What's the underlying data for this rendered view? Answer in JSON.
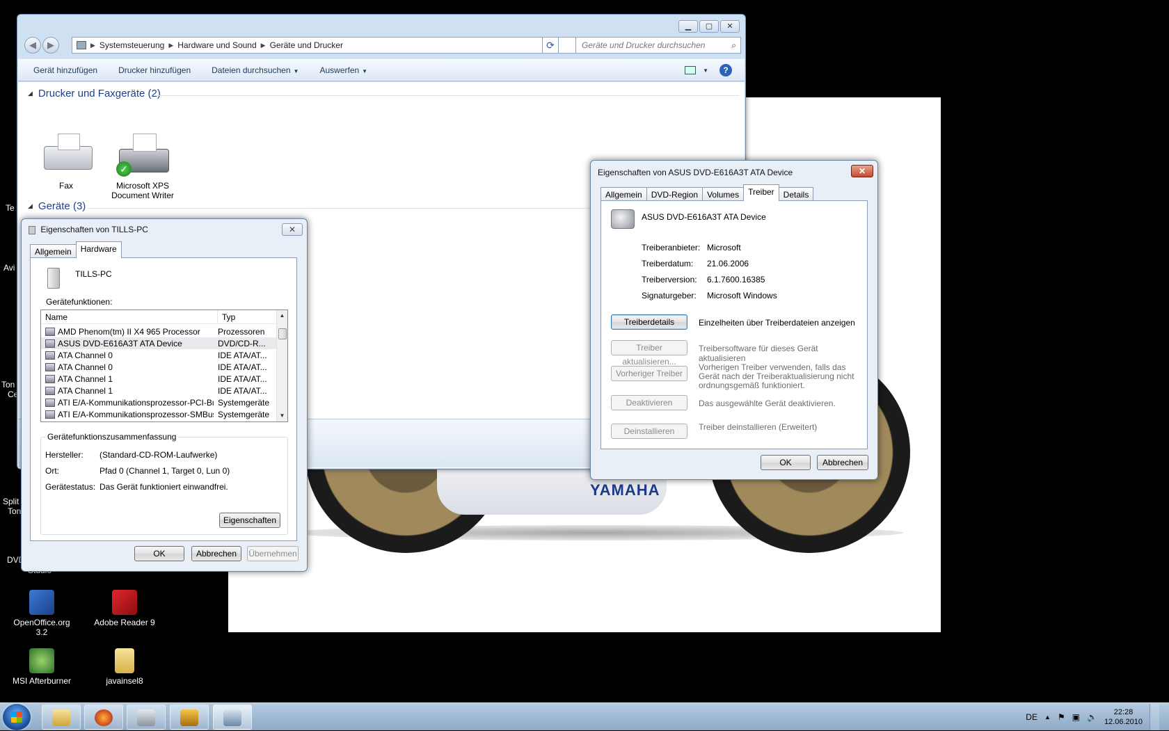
{
  "colors": {
    "accent": "#1e3f8a",
    "taskbar": "#9fb8d3"
  },
  "wallpaper": {
    "brand": "YAMAHA"
  },
  "desktop": {
    "icons": [
      {
        "label": "OpenOffice.org 3.2",
        "icon": "openoffice-icon"
      },
      {
        "label": "Adobe Reader 9",
        "icon": "adobe-reader-icon"
      },
      {
        "label": "MSI Afterburner",
        "icon": "msi-afterburner-icon"
      },
      {
        "label": "javainsel8",
        "icon": "folder-icon"
      }
    ],
    "edge_labels": [
      "Te",
      "Avi",
      "Ton",
      "Ce",
      "Split",
      "Ton",
      "DVD",
      "Studio"
    ]
  },
  "explorer": {
    "breadcrumb": [
      "Systemsteuerung",
      "Hardware und Sound",
      "Geräte und Drucker"
    ],
    "search_placeholder": "Geräte und Drucker durchsuchen",
    "commands": {
      "add_device": "Gerät hinzufügen",
      "add_printer": "Drucker hinzufügen",
      "browse_files": "Dateien durchsuchen",
      "eject": "Auswerfen"
    },
    "groups": {
      "printers": "Drucker und Faxgeräte (2)",
      "devices": "Geräte (3)"
    },
    "printers": [
      {
        "label": "Fax"
      },
      {
        "label_line1": "Microsoft XPS",
        "label_line2": "Document Writer"
      }
    ]
  },
  "pc_dialog": {
    "title": "Eigenschaften von TILLS-PC",
    "tabs": [
      "Allgemein",
      "Hardware"
    ],
    "active_tab": "Hardware",
    "device_name": "TILLS-PC",
    "functions_label": "Gerätefunktionen:",
    "columns": [
      "Name",
      "Typ"
    ],
    "rows": [
      {
        "name": "AMD Phenom(tm) II X4 965 Processor",
        "type": "Prozessoren"
      },
      {
        "name": "ASUS DVD-E616A3T ATA Device",
        "type": "DVD/CD-R..."
      },
      {
        "name": "ATA Channel 0",
        "type": "IDE ATA/AT..."
      },
      {
        "name": "ATA Channel 0",
        "type": "IDE ATA/AT..."
      },
      {
        "name": "ATA Channel 1",
        "type": "IDE ATA/AT..."
      },
      {
        "name": "ATA Channel 1",
        "type": "IDE ATA/AT..."
      },
      {
        "name": "ATI E/A-Kommunikationsprozessor-PCI-Busco...",
        "type": "Systemgeräte"
      },
      {
        "name": "ATI E/A-Kommunikationsprozessor-SMBus-Co...",
        "type": "Systemgeräte"
      }
    ],
    "summary": {
      "title": "Gerätefunktionszusammenfassung",
      "manufacturer_label": "Hersteller:",
      "manufacturer": "(Standard-CD-ROM-Laufwerke)",
      "location_label": "Ort:",
      "location": "Pfad 0 (Channel 1, Target 0, Lun 0)",
      "status_label": "Gerätestatus:",
      "status": "Das Gerät funktioniert einwandfrei.",
      "properties_button": "Eigenschaften"
    },
    "buttons": {
      "ok": "OK",
      "cancel": "Abbrechen",
      "apply": "Übernehmen"
    }
  },
  "dvd_dialog": {
    "title": "Eigenschaften von ASUS DVD-E616A3T ATA Device",
    "tabs": [
      "Allgemein",
      "DVD-Region",
      "Volumes",
      "Treiber",
      "Details"
    ],
    "active_tab": "Treiber",
    "device_name": "ASUS DVD-E616A3T ATA Device",
    "fields": [
      {
        "label": "Treiberanbieter:",
        "value": "Microsoft"
      },
      {
        "label": "Treiberdatum:",
        "value": "21.06.2006"
      },
      {
        "label": "Treiberversion:",
        "value": "6.1.7600.16385"
      },
      {
        "label": "Signaturgeber:",
        "value": "Microsoft Windows"
      }
    ],
    "actions": [
      {
        "button": "Treiberdetails",
        "desc": "Einzelheiten über Treiberdateien anzeigen"
      },
      {
        "button": "Treiber aktualisieren...",
        "desc": "Treibersoftware für dieses Gerät aktualisieren"
      },
      {
        "button": "Vorheriger Treiber",
        "desc": "Vorherigen Treiber verwenden, falls das Gerät nach der Treiberaktualisierung nicht ordnungsgemäß funktioniert."
      },
      {
        "button": "Deaktivieren",
        "desc": "Das ausgewählte Gerät deaktivieren."
      },
      {
        "button": "Deinstallieren",
        "desc": "Treiber deinstallieren (Erweitert)"
      }
    ],
    "buttons": {
      "ok": "OK",
      "cancel": "Abbrechen"
    }
  },
  "taskbar": {
    "language": "DE",
    "time": "22:28",
    "date": "12.06.2010"
  }
}
